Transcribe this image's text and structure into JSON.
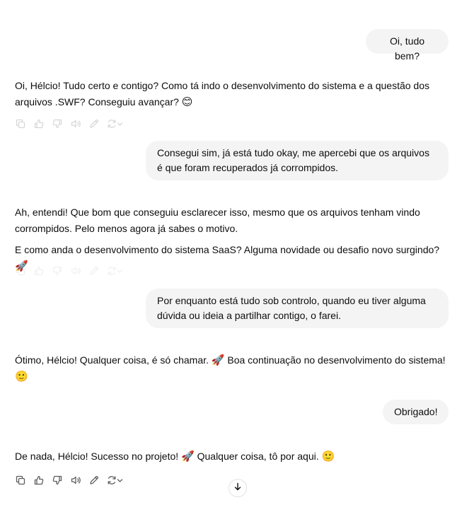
{
  "messages": {
    "u1": "Oi, tudo bem?",
    "a1": "Oi, Hélcio! Tudo certo e contigo? Como tá indo o desenvolvimento do sistema e a questão dos arquivos .SWF? Conseguiu avançar?",
    "u2": "Consegui sim, já está tudo okay, me apercebi que os arquivos é que foram recuperados já corrompidos.",
    "a2_p1": "Ah, entendi! Que bom que conseguiu esclarecer isso, mesmo que os arquivos tenham vindo corrompidos. Pelo menos agora já sabes o motivo.",
    "a2_p2": "E como anda o desenvolvimento do sistema SaaS? Alguma novidade ou desafio novo surgindo?",
    "u3": "Por enquanto está tudo sob controlo, quando eu tiver alguma dúvida ou ideia a partilhar contigo, o farei.",
    "a3_part1": "Ótimo, Hélcio! Qualquer coisa, é só chamar.",
    "a3_part2": "Boa continuação no desenvolvimento do sistema!",
    "u4": "Obrigado!",
    "a4_part1": "De nada, Hélcio! Sucesso no projeto!",
    "a4_part2": "Qualquer coisa, tô por aqui."
  },
  "emoji": {
    "smile": "😊",
    "rocket": "🚀",
    "slight_smile": "🙂"
  },
  "icons": [
    "copy-icon",
    "thumbs-up-icon",
    "thumbs-down-icon",
    "read-aloud-icon",
    "edit-icon",
    "regenerate-icon",
    "chevron-down-icon",
    "arrow-down-icon"
  ],
  "colors": {
    "background": "#ffffff",
    "user_bubble": "#f4f4f4",
    "text": "#0d0d0d",
    "icon": "#8e8e8e"
  }
}
